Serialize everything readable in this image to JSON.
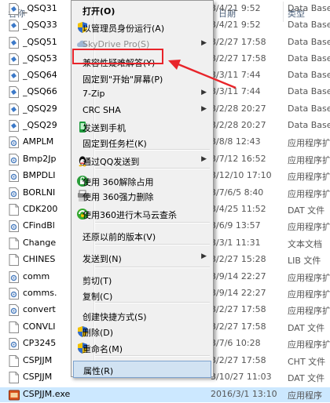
{
  "header": {
    "name": "名称",
    "date": "日期",
    "type": "类型"
  },
  "files": [
    {
      "name": "_QSQ31",
      "date": "3/4/21 9:52",
      "type": "Data Base",
      "icon": "file-doc-icon"
    },
    {
      "name": "_QSQ33",
      "date": "3/4/21 9:52",
      "type": "Data Base",
      "icon": "file-doc-icon"
    },
    {
      "name": "_QSQ51",
      "date": "3/2/27 17:58",
      "type": "Data Base",
      "icon": "file-doc-icon"
    },
    {
      "name": "_QSQ53",
      "date": "3/2/27 17:58",
      "type": "Data Base",
      "icon": "file-doc-icon"
    },
    {
      "name": "_QSQ64",
      "date": "3/3/11 7:44",
      "type": "Data Base",
      "icon": "file-doc-icon"
    },
    {
      "name": "_QSQ66",
      "date": "3/3/11 7:44",
      "type": "Data Base",
      "icon": "file-doc-icon"
    },
    {
      "name": "_QSQ29",
      "date": "3/2/28 20:27",
      "type": "Data Base",
      "icon": "file-doc-icon"
    },
    {
      "name": "_QSQ29",
      "date": "3/2/28 20:27",
      "type": "Data Base",
      "icon": "file-doc-icon"
    },
    {
      "name": "AMPLM",
      "date": "3/8/8 12:43",
      "type": "应用程序扩",
      "icon": "dll-icon"
    },
    {
      "name": "Bmp2Jp",
      "date": "3/7/12 16:52",
      "type": "应用程序扩",
      "icon": "dll-icon"
    },
    {
      "name": "BMPDLI",
      "date": "3/12/10 17:10",
      "type": "应用程序扩",
      "icon": "dll-icon"
    },
    {
      "name": "BORLNI",
      "date": "3/7/6/5 8:40",
      "type": "应用程序扩",
      "icon": "dll-icon"
    },
    {
      "name": "CDK200",
      "date": "3/4/25 11:52",
      "type": "DAT 文件",
      "icon": "file-blank-icon"
    },
    {
      "name": "CFindBl",
      "date": "3/6/9 13:57",
      "type": "应用程序扩",
      "icon": "dll-icon"
    },
    {
      "name": "Change",
      "date": "3/3/1 11:31",
      "type": "文本文档",
      "icon": "file-blank-icon"
    },
    {
      "name": "CHINES",
      "date": "3/2/27 15:28",
      "type": "LIB 文件",
      "icon": "file-blank-icon"
    },
    {
      "name": "comm",
      "date": "3/9/14 22:27",
      "type": "应用程序扩",
      "icon": "dll-icon"
    },
    {
      "name": "comms.",
      "date": "3/9/14 22:27",
      "type": "应用程序扩",
      "icon": "dll-icon"
    },
    {
      "name": "convert",
      "date": "3/2/27 17:58",
      "type": "应用程序扩",
      "icon": "dll-icon"
    },
    {
      "name": "CONVLI",
      "date": "3/2/27 17:58",
      "type": "DAT 文件",
      "icon": "file-blank-icon"
    },
    {
      "name": "CP3245",
      "date": "3/7/6 10:28",
      "type": "应用程序扩",
      "icon": "dll-icon"
    },
    {
      "name": "CSPJJM",
      "date": "3/2/27 17:58",
      "type": "CHT 文件",
      "icon": "file-blank-icon"
    },
    {
      "name": "CSPJJM",
      "date": "3/10/27 11:03",
      "type": "DAT 文件",
      "icon": "file-blank-icon"
    },
    {
      "name": "CSPJJM.exe",
      "date": "2016/3/1 13:10",
      "type": "应用程序",
      "icon": "exe-icon"
    }
  ],
  "menu": {
    "items": [
      {
        "label": "打开(O)",
        "bold": true
      },
      {
        "label": "以管理员身份运行(A)",
        "icon": "uac-shield-icon"
      },
      {
        "label": "SkyDrive Pro(S)",
        "icon": "skydrive-icon",
        "disabled": true,
        "submenu": true
      },
      {
        "label": "兼容性疑难解答(Y)"
      },
      {
        "label": "固定到\"开始\"屏幕(P)"
      },
      {
        "label": "7-Zip",
        "submenu": true
      },
      {
        "label": "CRC SHA",
        "submenu": true
      },
      {
        "label": "发送到手机",
        "icon": "phone-icon"
      },
      {
        "label": "固定到任务栏(K)"
      },
      {
        "label": "通过QQ发送到",
        "icon": "qq-icon",
        "submenu": true
      },
      {
        "label": "使用 360解除占用",
        "icon": "unlock-360-icon"
      },
      {
        "label": "使用 360强力删除",
        "icon": "shred-360-icon"
      },
      {
        "label": "使用360进行木马云查杀",
        "icon": "scan-360-icon"
      },
      {
        "label": "还原以前的版本(V)"
      },
      {
        "label": "发送到(N)",
        "submenu": true
      },
      {
        "label": "剪切(T)"
      },
      {
        "label": "复制(C)"
      },
      {
        "label": "创建快捷方式(S)"
      },
      {
        "label": "删除(D)",
        "icon": "uac-shield-icon"
      },
      {
        "label": "重命名(M)",
        "icon": "uac-shield-icon"
      },
      {
        "label": "属性(R)",
        "highlighted": true
      }
    ],
    "submenu_glyph": "▶"
  },
  "colors": {
    "annotation": "#e8242a",
    "selection": "#cce8ff",
    "menu_bg": "#f0f0f0"
  }
}
